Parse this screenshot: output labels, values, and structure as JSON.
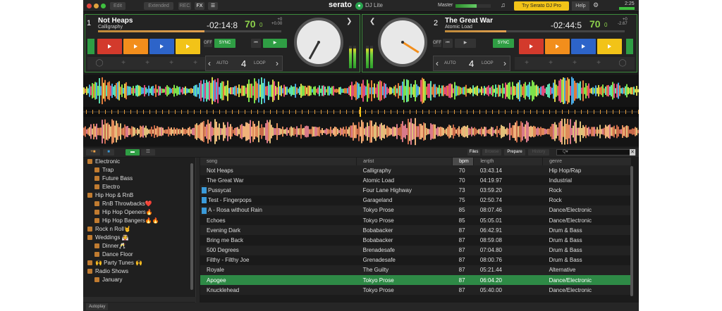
{
  "topbar": {
    "buttons": [
      "Edit",
      "Extended",
      "REC",
      "FX"
    ],
    "logo": "serato",
    "product": "DJ Lite",
    "master_label": "Master",
    "try_button": "Try Serato DJ Pro",
    "help_button": "Help",
    "clock": "2:25"
  },
  "decks": [
    {
      "number": "1",
      "title": "Not Heaps",
      "artist": "Calligraphy",
      "time": "-02:14:8",
      "bpm": "70",
      "bpm_suffix": "0",
      "pitch_top": "+0",
      "pitch_bottom": "+0.00",
      "sync": "SYNC",
      "off": "OFF",
      "auto": "AUTO",
      "loop_size": "4",
      "loop": "LOOP",
      "position": 0.58,
      "pads": [
        "#d33a2c",
        "#f28e1c",
        "#2d64c9",
        "#f2c318"
      ]
    },
    {
      "number": "2",
      "title": "The Great War",
      "artist": "Atomic Load",
      "time": "-02:44:5",
      "bpm": "70",
      "bpm_suffix": "0",
      "pitch_top": "+0",
      "pitch_bottom": "-2.67",
      "sync": "SYNC",
      "off": "OFF",
      "auto": "AUTO",
      "loop_size": "4",
      "loop": "LOOP",
      "position": 0.34,
      "pads": [
        "#d33a2c",
        "#f28e1c",
        "#2d64c9",
        "#f2c318"
      ]
    }
  ],
  "library": {
    "buttons": [
      "Files",
      "Browse",
      "Prepare",
      "History"
    ],
    "search_placeholder": "Q▾"
  },
  "crates": [
    {
      "label": "Electronic",
      "level": 0
    },
    {
      "label": "Trap",
      "level": 1
    },
    {
      "label": "Future Bass",
      "level": 1
    },
    {
      "label": "Electro",
      "level": 1
    },
    {
      "label": "Hip Hop & RnB",
      "level": 0
    },
    {
      "label": "RnB Throwbacks❤️",
      "level": 1
    },
    {
      "label": "Hip Hop Openers🔥",
      "level": 1
    },
    {
      "label": "Hip Hop Bangers🔥🔥",
      "level": 1
    },
    {
      "label": "Rock n Roll🤘",
      "level": 0
    },
    {
      "label": "Weddings 👰",
      "level": 0
    },
    {
      "label": "Dinner🥂",
      "level": 1
    },
    {
      "label": "Dance Floor",
      "level": 1
    },
    {
      "label": "🙌 Party Tunes 🙌",
      "level": 0
    },
    {
      "label": "Radio Shows",
      "level": 0
    },
    {
      "label": "January",
      "level": 1
    }
  ],
  "tracks": {
    "columns": [
      "song",
      "artist",
      "bpm",
      "length",
      "genre"
    ],
    "sorted_column": "bpm",
    "rows": [
      {
        "song": "Not Heaps",
        "artist": "Calligraphy",
        "bpm": "70",
        "length": "03:43.14",
        "genre": "Hip Hop/Rap",
        "tag": false
      },
      {
        "song": "The Great War",
        "artist": "Atomic Load",
        "bpm": "70",
        "length": "04:19.97",
        "genre": "Industrial",
        "tag": false
      },
      {
        "song": "Pussycat",
        "artist": "Four Lane Highway",
        "bpm": "73",
        "length": "03:59.20",
        "genre": "Rock",
        "tag": true
      },
      {
        "song": "Test - Fingerpops",
        "artist": "Garageland",
        "bpm": "75",
        "length": "02:50.74",
        "genre": "Rock",
        "tag": true
      },
      {
        "song": "A - Rosa without Rain",
        "artist": "Tokyo Prose",
        "bpm": "85",
        "length": "08:07.46",
        "genre": "Dance/Electronic",
        "tag": true
      },
      {
        "song": "Echoes",
        "artist": "Tokyo Prose",
        "bpm": "85",
        "length": "05:05.01",
        "genre": "Dance/Electronic",
        "tag": false
      },
      {
        "song": "Evening Dark",
        "artist": "Bobabacker",
        "bpm": "87",
        "length": "06:42.91",
        "genre": "Drum & Bass",
        "tag": false
      },
      {
        "song": "Bring me Back",
        "artist": "Bobabacker",
        "bpm": "87",
        "length": "08:59.08",
        "genre": "Drum & Bass",
        "tag": false
      },
      {
        "song": "500 Degrees",
        "artist": "Brenadesafe",
        "bpm": "87",
        "length": "07:04.80",
        "genre": "Drum & Bass",
        "tag": false
      },
      {
        "song": "Filthy - Filthy Joe",
        "artist": "Grenadesafe",
        "bpm": "87",
        "length": "08:00.76",
        "genre": "Drum & Bass",
        "tag": false
      },
      {
        "song": "Royale",
        "artist": "The Guilty",
        "bpm": "87",
        "length": "05:21.44",
        "genre": "Alternative",
        "tag": false
      },
      {
        "song": "Apogee",
        "artist": "Tokyo Prose",
        "bpm": "87",
        "length": "06:04.20",
        "genre": "Dance/Electronic",
        "tag": false,
        "selected": true
      },
      {
        "song": "Knucklehead",
        "artist": "Tokyo Prose",
        "bpm": "87",
        "length": "05:40.00",
        "genre": "Dance/Electronic",
        "tag": false
      }
    ]
  },
  "bottombar": {
    "autoplay": "Autoplay"
  }
}
